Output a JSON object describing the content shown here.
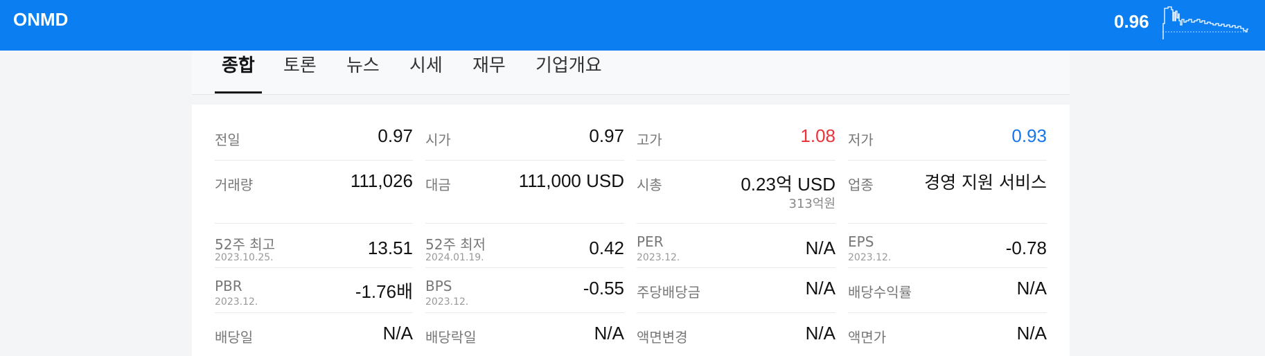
{
  "header": {
    "ticker": "ONMD",
    "price": "0.96"
  },
  "tabs": [
    "종합",
    "토론",
    "뉴스",
    "시세",
    "재무",
    "기업개요"
  ],
  "stats": {
    "row1": [
      {
        "label": "전일",
        "value": "0.97"
      },
      {
        "label": "시가",
        "value": "0.97"
      },
      {
        "label": "고가",
        "value": "1.08"
      },
      {
        "label": "저가",
        "value": "0.93"
      }
    ],
    "row2": [
      {
        "label": "거래량",
        "value": "111,026"
      },
      {
        "label": "대금",
        "value": "111,000 USD"
      },
      {
        "label": "시총",
        "value": "0.23억 USD",
        "sub": "313억원"
      },
      {
        "label": "업종",
        "value": "경영 지원 서비스"
      }
    ],
    "row3": [
      {
        "label": "52주 최고",
        "date": "2023.10.25.",
        "value": "13.51"
      },
      {
        "label": "52주 최저",
        "date": "2024.01.19.",
        "value": "0.42"
      },
      {
        "label": "PER",
        "date": "2023.12.",
        "value": "N/A"
      },
      {
        "label": "EPS",
        "date": "2023.12.",
        "value": "-0.78"
      }
    ],
    "row4": [
      {
        "label": "PBR",
        "date": "2023.12.",
        "value": "-1.76배"
      },
      {
        "label": "BPS",
        "date": "2023.12.",
        "value": "-0.55"
      },
      {
        "label": "주당배당금",
        "value": "N/A"
      },
      {
        "label": "배당수익률",
        "value": "N/A"
      }
    ],
    "row5": [
      {
        "label": "배당일",
        "value": "N/A"
      },
      {
        "label": "배당락일",
        "value": "N/A"
      },
      {
        "label": "액면변경",
        "value": "N/A"
      },
      {
        "label": "액면가",
        "value": "N/A"
      }
    ]
  },
  "colors": {
    "brand": "#0b7ff2",
    "up": "#e8343a",
    "down": "#1676ea"
  }
}
